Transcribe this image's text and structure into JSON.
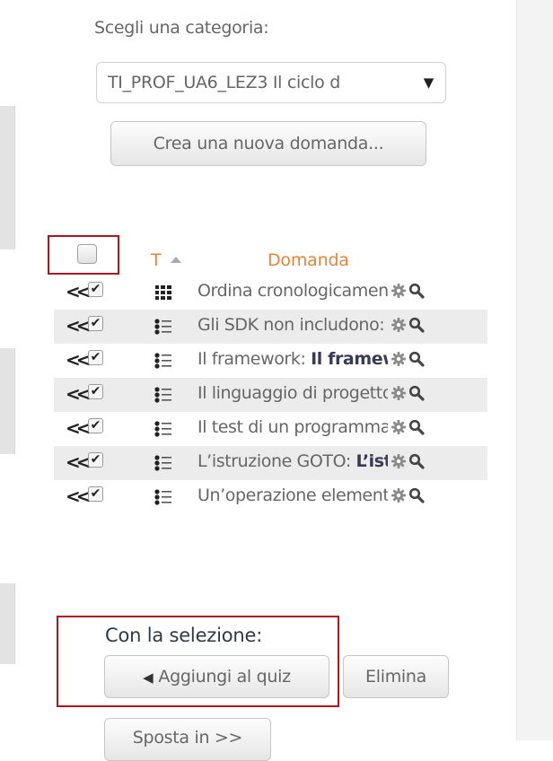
{
  "category": {
    "label": "Scegli una categoria:",
    "selected": "TI_PROF_UA6_LEZ3 Il ciclo d"
  },
  "create_button": "Crea una nuova domanda...",
  "table": {
    "header_type": "T",
    "header_question": "Domanda",
    "rows": [
      {
        "icon": "ordering-question-icon",
        "text": "Ordina cronologicamen",
        "bold": "",
        "checked": true
      },
      {
        "icon": "multichoice-question-icon",
        "text": "Gli SDK non includono: ",
        "bold": "",
        "checked": true
      },
      {
        "icon": "multichoice-question-icon",
        "text": "Il framework: ",
        "bold": "Il framew",
        "checked": true
      },
      {
        "icon": "multichoice-question-icon",
        "text": "Il linguaggio di progetto",
        "bold": "",
        "checked": true
      },
      {
        "icon": "multichoice-question-icon",
        "text": "Il test di un programma",
        "bold": "",
        "checked": true
      },
      {
        "icon": "multichoice-question-icon",
        "text": "L’istruzione GOTO: ",
        "bold": "L’ist",
        "checked": true
      },
      {
        "icon": "multichoice-question-icon",
        "text": "Un’operazione element",
        "bold": "",
        "checked": true
      }
    ]
  },
  "selection": {
    "label": "Con la selezione:",
    "add_to_quiz": "Aggiungi al quiz",
    "delete": "Elimina",
    "move_to": "Sposta in >>"
  },
  "colors": {
    "highlight": "#b3121f",
    "header_text": "#e8843a"
  }
}
